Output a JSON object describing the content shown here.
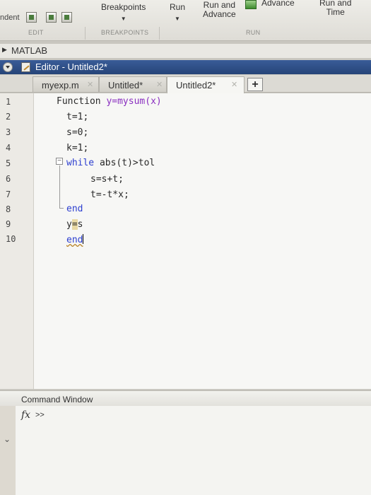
{
  "toolstrip": {
    "indent_label": "ndent",
    "breakpoints_label": "Breakpoints",
    "run_label": "Run",
    "run_and_advance_label": "Run and\nAdvance",
    "advance_label": "Advance",
    "run_and_time_label": "Run and\nTime",
    "section_edit": "EDIT",
    "section_breakpoints": "BREAKPOINTS",
    "section_run": "RUN"
  },
  "pathbar": {
    "label": "MATLAB"
  },
  "editor": {
    "title": "Editor - Untitled2*",
    "tabs": [
      {
        "label": "myexp.m"
      },
      {
        "label": "Untitled*"
      },
      {
        "label": "Untitled2*"
      }
    ],
    "plus_label": "+",
    "line_numbers": [
      "1",
      "2",
      "3",
      "4",
      "5",
      "6",
      "7",
      "8",
      "9",
      "10"
    ],
    "code": {
      "l1_kw": "Function",
      "l1_rest": "y=mysum(x)",
      "l2": "t=1;",
      "l3": "s=0;",
      "l4": "k=1;",
      "l5_kw": "while",
      "l5_rest": " abs(t)>tol",
      "l6": "s=s+t;",
      "l7": "t=-t*x;",
      "l8": "end",
      "l9_a": "y",
      "l9_b": "=",
      "l9_c": "s",
      "l10": "end"
    }
  },
  "command_window": {
    "title": "Command Window",
    "fx_label": "fx",
    "prompt": ">>"
  },
  "colors": {
    "keyword": "#2d3fd0",
    "function_name": "#8a2fc0",
    "title_bar": "#2f4f88"
  }
}
